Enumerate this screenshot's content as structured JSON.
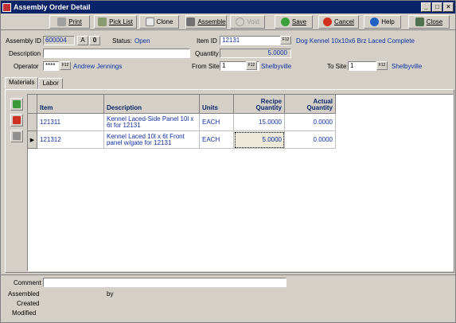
{
  "window": {
    "title": "Assembly Order Detail",
    "min": "_",
    "max": "□",
    "close": "×"
  },
  "toolbar": {
    "print": "Print",
    "pick_list": "Pick List",
    "clone": "Clone",
    "assemble": "Assemble",
    "void": "Void",
    "save": "Save",
    "cancel": "Cancel",
    "help": "Help",
    "close": "Close",
    "icons": [
      "print-icon",
      "pick-list-icon",
      "clone-icon",
      "assemble-icon",
      "void-icon",
      "save-icon",
      "cancel-icon",
      "help-icon",
      "close-icon"
    ]
  },
  "header": {
    "assembly_id_label": "Assembly ID",
    "assembly_id": "600004",
    "status_btn_a": "A",
    "status_btn_0": "0",
    "status_label": "Status:",
    "status_value": "Open",
    "item_id_label": "Item ID",
    "item_id": "12131",
    "item_desc": "Dog Kennel  10x10x6 Brz Laced  Complete",
    "description_label": "Description",
    "description": "",
    "quantity_label": "Quantity",
    "quantity": "5.0000",
    "operator_label": "Operator",
    "operator": "****",
    "operator_name": "Andrew Jennings",
    "from_site_label": "From Site",
    "from_site": "1",
    "from_site_name": "Shelbyville",
    "to_site_label": "To Site",
    "to_site": "1",
    "to_site_name": "Shelbyville",
    "f12": "F12"
  },
  "tabs": [
    "Materials",
    "Labor"
  ],
  "grid": {
    "columns": [
      "Item",
      "Description",
      "Units",
      "Recipe Quantity",
      "Actual Quantity"
    ],
    "rows": [
      {
        "item": "121311",
        "description": "Kennel Laced-Side Panel 10l x 6t for 12131",
        "units": "EACH",
        "recipe": "15.0000",
        "actual": "0.0000"
      },
      {
        "item": "121312",
        "description": "Kennel Laced 10l x 6t Front panel w/gate for 12131",
        "units": "EACH",
        "recipe": "5.0000",
        "actual": "0.0000"
      }
    ]
  },
  "footer": {
    "comment_label": "Comment",
    "comment": "",
    "assembled_label": "Assembled",
    "by_label": "by",
    "created_label": "Created",
    "modified_label": "Modified"
  },
  "colors": {
    "title_bar": "#0a246a",
    "value_text": "#1030a0",
    "face": "#d4d0c8"
  }
}
